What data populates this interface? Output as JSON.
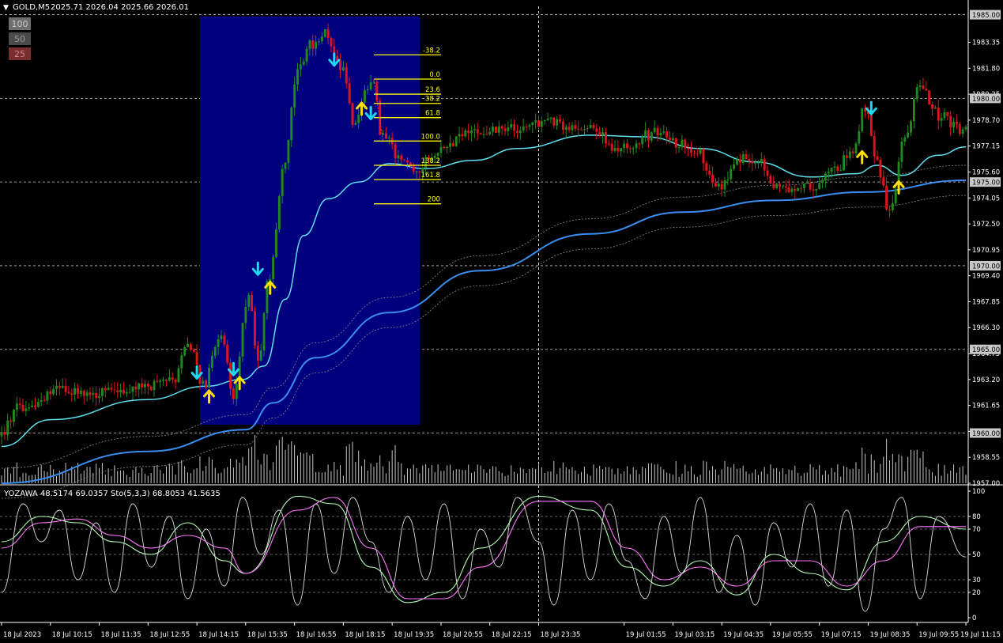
{
  "header": {
    "symbol": "GOLD,M5",
    "ohlc": "2025.71 2026.04 2025.66 2026.01",
    "scale_boxes": [
      {
        "label": "100",
        "color": "#6e6e6e",
        "text_color": "#c8c8c8"
      },
      {
        "label": "50",
        "color": "#4a4a4a",
        "text_color": "#9a9a9a"
      },
      {
        "label": "25",
        "color": "#7a2d2d",
        "text_color": "#d08a8a"
      }
    ]
  },
  "subwindow": {
    "label": "YOZAWA 48.5174 69.0357  Sto(5,3,3) 68.8053 41.5635"
  },
  "colors": {
    "background": "#000000",
    "bull": "#1f8a1f",
    "bear": "#e0141e",
    "fib_box": "#00007f",
    "fib_line": "#ffff00",
    "ma_fast": "#5ee0f0",
    "ma_slow": "#3a8ef0",
    "band": "#8a8a8a",
    "arrow_up": "#ffe000",
    "arrow_down": "#20d8f0",
    "grid": "#c8c8c8",
    "volume": "#c8c8c8",
    "stoch_k": "#b4ffb4",
    "stoch_d": "#ff78ff",
    "osc": "#dcdcdc"
  },
  "chart_data": [
    {
      "type": "candlestick",
      "symbol": "GOLD",
      "timeframe": "M5",
      "price_ticks": [
        "1983.35",
        "1981.80",
        "1980.25",
        "1978.70",
        "1977.15",
        "1975.60",
        "1974.05",
        "1972.50",
        "1970.95",
        "1969.40",
        "1967.85",
        "1966.30",
        "1964.75",
        "1963.20",
        "1961.65",
        "1960.10",
        "1958.55",
        "1957.00"
      ],
      "price_ticks_values": [
        1983.35,
        1981.8,
        1980.25,
        1978.7,
        1977.15,
        1975.6,
        1974.05,
        1972.5,
        1970.95,
        1969.4,
        1967.85,
        1966.3,
        1964.75,
        1963.2,
        1961.65,
        1960.1,
        1958.55,
        1957.0
      ],
      "highlighted_levels": [
        "1985.00",
        "1980.00",
        "1975.00",
        "1970.00",
        "1965.00",
        "1960.00"
      ],
      "highlighted_levels_values": [
        1985,
        1980,
        1975,
        1970,
        1965,
        1960
      ],
      "ylim": [
        1957.0,
        1985.5
      ],
      "fib_levels": [
        {
          "label": "-38.2",
          "price": 1982.6
        },
        {
          "label": "0.0",
          "price": 1981.15
        },
        {
          "label": "23.6",
          "price": 1980.25
        },
        {
          "label": "38.2",
          "price": 1979.7
        },
        {
          "label": "61.8",
          "price": 1978.85
        },
        {
          "label": "100.0",
          "price": 1977.45
        },
        {
          "label": "138.2",
          "price": 1976.0
        },
        {
          "label": "161.8",
          "price": 1975.15
        },
        {
          "label": "200",
          "price": 1973.7
        }
      ],
      "fib_box": {
        "start": "18 Jul 14:20",
        "end": "18 Jul 20:20",
        "price_high": 1984.9,
        "price_low": 1960.5
      },
      "anchors": [
        {
          "time": "18 Jul 2023 08:55",
          "price": 1959.8
        },
        {
          "time": "18 Jul 09:30",
          "price": 1961.5
        },
        {
          "time": "18 Jul 10:30",
          "price": 1962.5
        },
        {
          "time": "18 Jul 12:00",
          "price": 1962.4
        },
        {
          "time": "18 Jul 13:40",
          "price": 1963.0
        },
        {
          "time": "18 Jul 14:05",
          "price": 1965.5
        },
        {
          "time": "18 Jul 14:30",
          "price": 1962.8
        },
        {
          "time": "18 Jul 15:00",
          "price": 1966.0
        },
        {
          "time": "18 Jul 15:20",
          "price": 1962.0
        },
        {
          "time": "18 Jul 15:45",
          "price": 1968.5
        },
        {
          "time": "18 Jul 16:00",
          "price": 1964.5
        },
        {
          "time": "18 Jul 16:20",
          "price": 1969.5
        },
        {
          "time": "18 Jul 16:45",
          "price": 1976.5
        },
        {
          "time": "18 Jul 17:05",
          "price": 1981.8
        },
        {
          "time": "18 Jul 17:30",
          "price": 1983.3
        },
        {
          "time": "18 Jul 17:50",
          "price": 1983.8
        },
        {
          "time": "18 Jul 18:15",
          "price": 1982.0
        },
        {
          "time": "18 Jul 18:40",
          "price": 1978.2
        },
        {
          "time": "18 Jul 18:55",
          "price": 1980.3
        },
        {
          "time": "18 Jul 19:10",
          "price": 1981.2
        },
        {
          "time": "18 Jul 19:20",
          "price": 1978.0
        },
        {
          "time": "18 Jul 19:50",
          "price": 1976.6
        },
        {
          "time": "18 Jul 20:20",
          "price": 1975.6
        },
        {
          "time": "18 Jul 20:50",
          "price": 1976.8
        },
        {
          "time": "18 Jul 21:40",
          "price": 1977.8
        },
        {
          "time": "18 Jul 22:30",
          "price": 1978.0
        },
        {
          "time": "18 Jul 23:50",
          "price": 1978.6
        },
        {
          "time": "19 Jul 00:55",
          "price": 1978.3
        },
        {
          "time": "19 Jul 01:55",
          "price": 1977.0
        },
        {
          "time": "19 Jul 02:50",
          "price": 1977.9
        },
        {
          "time": "19 Jul 03:55",
          "price": 1977.0
        },
        {
          "time": "19 Jul 04:40",
          "price": 1974.6
        },
        {
          "time": "19 Jul 05:05",
          "price": 1976.5
        },
        {
          "time": "19 Jul 05:40",
          "price": 1976.2
        },
        {
          "time": "19 Jul 06:15",
          "price": 1974.6
        },
        {
          "time": "19 Jul 07:15",
          "price": 1974.8
        },
        {
          "time": "19 Jul 07:45",
          "price": 1975.6
        },
        {
          "time": "19 Jul 08:15",
          "price": 1977.0
        },
        {
          "time": "19 Jul 08:35",
          "price": 1979.5
        },
        {
          "time": "19 Jul 08:55",
          "price": 1976.0
        },
        {
          "time": "19 Jul 09:15",
          "price": 1973.2
        },
        {
          "time": "19 Jul 09:40",
          "price": 1977.5
        },
        {
          "time": "19 Jul 10:05",
          "price": 1980.8
        },
        {
          "time": "19 Jul 10:35",
          "price": 1979.0
        },
        {
          "time": "19 Jul 11:15",
          "price": 1978.2
        }
      ],
      "ma_fast": [
        {
          "time": "18 Jul 2023 08:55",
          "price": 1959.2
        },
        {
          "time": "18 Jul 10:15",
          "price": 1960.8
        },
        {
          "time": "18 Jul 12:55",
          "price": 1962.0
        },
        {
          "time": "18 Jul 14:30",
          "price": 1962.8
        },
        {
          "time": "18 Jul 15:30",
          "price": 1963.2
        },
        {
          "time": "18 Jul 16:05",
          "price": 1964.0
        },
        {
          "time": "18 Jul 16:40",
          "price": 1968.0
        },
        {
          "time": "18 Jul 17:10",
          "price": 1971.8
        },
        {
          "time": "18 Jul 17:50",
          "price": 1974.0
        },
        {
          "time": "18 Jul 18:40",
          "price": 1975.0
        },
        {
          "time": "18 Jul 19:30",
          "price": 1976.1
        },
        {
          "time": "18 Jul 20:30",
          "price": 1975.8
        },
        {
          "time": "18 Jul 21:50",
          "price": 1976.3
        },
        {
          "time": "18 Jul 23:00",
          "price": 1977.0
        },
        {
          "time": "19 Jul 01:00",
          "price": 1977.8
        },
        {
          "time": "19 Jul 02:30",
          "price": 1977.7
        },
        {
          "time": "19 Jul 04:00",
          "price": 1977.0
        },
        {
          "time": "19 Jul 05:30",
          "price": 1976.2
        },
        {
          "time": "19 Jul 07:00",
          "price": 1975.3
        },
        {
          "time": "19 Jul 08:15",
          "price": 1975.5
        },
        {
          "time": "19 Jul 08:50",
          "price": 1976.0
        },
        {
          "time": "19 Jul 09:30",
          "price": 1975.4
        },
        {
          "time": "19 Jul 10:30",
          "price": 1976.6
        },
        {
          "time": "19 Jul 11:15",
          "price": 1977.1
        }
      ],
      "ma_slow": [
        {
          "time": "18 Jul 2023 08:55",
          "price": 1957.0
        },
        {
          "time": "18 Jul 12:55",
          "price": 1958.9
        },
        {
          "time": "18 Jul 15:35",
          "price": 1960.2
        },
        {
          "time": "18 Jul 16:20",
          "price": 1961.8
        },
        {
          "time": "18 Jul 17:30",
          "price": 1964.5
        },
        {
          "time": "18 Jul 19:30",
          "price": 1967.2
        },
        {
          "time": "18 Jul 22:00",
          "price": 1969.7
        },
        {
          "time": "19 Jul 01:00",
          "price": 1971.9
        },
        {
          "time": "19 Jul 03:30",
          "price": 1973.2
        },
        {
          "time": "19 Jul 06:00",
          "price": 1973.9
        },
        {
          "time": "19 Jul 08:30",
          "price": 1974.4
        },
        {
          "time": "19 Jul 11:15",
          "price": 1975.1
        }
      ],
      "signals": [
        {
          "dir": "down",
          "time": "18 Jul 14:15",
          "price": 1963.5
        },
        {
          "dir": "up",
          "time": "18 Jul 14:35",
          "price": 1962.3
        },
        {
          "dir": "down",
          "time": "18 Jul 15:15",
          "price": 1963.7
        },
        {
          "dir": "up",
          "time": "18 Jul 15:25",
          "price": 1963.1
        },
        {
          "dir": "down",
          "time": "18 Jul 15:55",
          "price": 1969.7
        },
        {
          "dir": "up",
          "time": "18 Jul 16:15",
          "price": 1968.8
        },
        {
          "dir": "down",
          "time": "18 Jul 18:00",
          "price": 1982.2
        },
        {
          "dir": "up",
          "time": "18 Jul 18:45",
          "price": 1979.5
        },
        {
          "dir": "down",
          "time": "18 Jul 19:00",
          "price": 1979.0
        },
        {
          "dir": "up",
          "time": "19 Jul 08:25",
          "price": 1976.6
        },
        {
          "dir": "down",
          "time": "19 Jul 08:40",
          "price": 1979.3
        },
        {
          "dir": "up",
          "time": "19 Jul 09:25",
          "price": 1974.8
        }
      ],
      "x_ticks": [
        "18 Jul 2023",
        "18 Jul 10:15",
        "18 Jul 11:35",
        "18 Jul 12:55",
        "18 Jul 14:15",
        "18 Jul 15:35",
        "18 Jul 16:55",
        "18 Jul 18:15",
        "18 Jul 19:35",
        "18 Jul 20:55",
        "18 Jul 22:15",
        "18 Jul 23:35",
        "19 Jul 01:55",
        "19 Jul 03:15",
        "19 Jul 04:35",
        "19 Jul 05:55",
        "19 Jul 07:15",
        "19 Jul 08:35",
        "19 Jul 09:55",
        "19 Jul 11:15"
      ],
      "x_ticks_values": [
        "18 Jul 2023 08:55",
        "18 Jul 10:15",
        "18 Jul 11:35",
        "18 Jul 12:55",
        "18 Jul 14:15",
        "18 Jul 15:35",
        "18 Jul 16:55",
        "18 Jul 18:15",
        "18 Jul 19:35",
        "18 Jul 20:55",
        "18 Jul 22:15",
        "18 Jul 23:35",
        "19 Jul 01:55",
        "19 Jul 03:15",
        "19 Jul 04:35",
        "19 Jul 05:55",
        "19 Jul 07:15",
        "19 Jul 08:35",
        "19 Jul 09:55",
        "19 Jul 11:15"
      ],
      "crosshair_time": "18 Jul 23:35",
      "grid": true
    },
    {
      "type": "line",
      "name": "YOZAWA / Sto(5,3,3)",
      "y_ticks": [
        "100",
        "80",
        "70",
        "50",
        "30",
        "20",
        "0"
      ],
      "y_ticks_values": [
        100,
        80,
        70,
        50,
        30,
        20,
        0
      ],
      "ylim": [
        0,
        100
      ],
      "series": [
        {
          "name": "Sto(5,3,3) main",
          "x": [
            "18 Jul 2023 08:55",
            "18 Jul 10:00",
            "18 Jul 11:00",
            "18 Jul 12:00",
            "18 Jul 13:00",
            "18 Jul 14:00",
            "18 Jul 15:00",
            "18 Jul 15:35",
            "18 Jul 17:00",
            "18 Jul 18:00",
            "18 Jul 19:00",
            "18 Jul 20:00",
            "18 Jul 21:00",
            "18 Jul 22:00",
            "18 Jul 23:35",
            "19 Jul 01:00",
            "19 Jul 02:00",
            "19 Jul 03:00",
            "19 Jul 04:00",
            "19 Jul 05:00",
            "19 Jul 06:00",
            "19 Jul 07:00",
            "19 Jul 08:00",
            "19 Jul 09:00",
            "19 Jul 10:00",
            "19 Jul 11:15"
          ],
          "y": [
            60,
            80,
            75,
            60,
            50,
            75,
            45,
            35,
            96,
            90,
            40,
            12,
            20,
            55,
            96,
            85,
            40,
            25,
            45,
            18,
            50,
            35,
            22,
            60,
            80,
            70
          ]
        },
        {
          "name": "Sto(5,3,3) signal",
          "x": [
            "18 Jul 2023 08:55",
            "18 Jul 10:00",
            "18 Jul 11:00",
            "18 Jul 12:00",
            "18 Jul 13:00",
            "18 Jul 14:00",
            "18 Jul 15:00",
            "18 Jul 15:35",
            "18 Jul 17:00",
            "18 Jul 18:00",
            "18 Jul 19:00",
            "18 Jul 20:00",
            "18 Jul 21:00",
            "18 Jul 22:00",
            "18 Jul 23:35",
            "19 Jul 01:00",
            "19 Jul 02:00",
            "19 Jul 03:00",
            "19 Jul 04:00",
            "19 Jul 05:00",
            "19 Jul 06:00",
            "19 Jul 07:00",
            "19 Jul 08:00",
            "19 Jul 09:00",
            "19 Jul 10:00",
            "19 Jul 11:15"
          ],
          "y": [
            55,
            75,
            78,
            65,
            55,
            65,
            55,
            35,
            85,
            95,
            55,
            15,
            15,
            40,
            92,
            92,
            55,
            30,
            40,
            25,
            45,
            45,
            25,
            45,
            72,
            72
          ]
        },
        {
          "name": "YOZAWA",
          "x": [
            "18 Jul 2023 08:55",
            "18 Jul 09:30",
            "18 Jul 10:00",
            "18 Jul 10:30",
            "18 Jul 11:00",
            "18 Jul 11:30",
            "18 Jul 12:00",
            "18 Jul 12:30",
            "18 Jul 13:00",
            "18 Jul 13:30",
            "18 Jul 14:00",
            "18 Jul 14:30",
            "18 Jul 15:00",
            "18 Jul 15:30",
            "18 Jul 16:00",
            "18 Jul 16:30",
            "18 Jul 17:00",
            "18 Jul 17:30",
            "18 Jul 18:00",
            "18 Jul 18:30",
            "18 Jul 19:00",
            "18 Jul 19:30",
            "18 Jul 20:00",
            "18 Jul 20:30",
            "18 Jul 21:00",
            "18 Jul 21:30",
            "18 Jul 22:00",
            "18 Jul 22:30",
            "18 Jul 23:00",
            "18 Jul 23:35",
            "19 Jul 00:00",
            "19 Jul 00:30",
            "19 Jul 01:00",
            "19 Jul 01:30",
            "19 Jul 02:00",
            "19 Jul 02:30",
            "19 Jul 03:00",
            "19 Jul 03:30",
            "19 Jul 04:00",
            "19 Jul 04:30",
            "19 Jul 05:00",
            "19 Jul 05:30",
            "19 Jul 06:00",
            "19 Jul 06:30",
            "19 Jul 07:00",
            "19 Jul 07:30",
            "19 Jul 08:00",
            "19 Jul 08:30",
            "19 Jul 09:00",
            "19 Jul 09:30",
            "19 Jul 10:00",
            "19 Jul 10:30",
            "19 Jul 11:15"
          ],
          "y": [
            20,
            90,
            60,
            85,
            30,
            75,
            20,
            90,
            40,
            80,
            15,
            70,
            25,
            95,
            50,
            85,
            10,
            90,
            35,
            95,
            60,
            20,
            80,
            30,
            90,
            15,
            70,
            40,
            95,
            60,
            10,
            85,
            30,
            90,
            45,
            15,
            80,
            35,
            95,
            20,
            65,
            10,
            75,
            40,
            90,
            25,
            85,
            5,
            70,
            95,
            15,
            80,
            48
          ]
        }
      ],
      "grid": true
    }
  ]
}
